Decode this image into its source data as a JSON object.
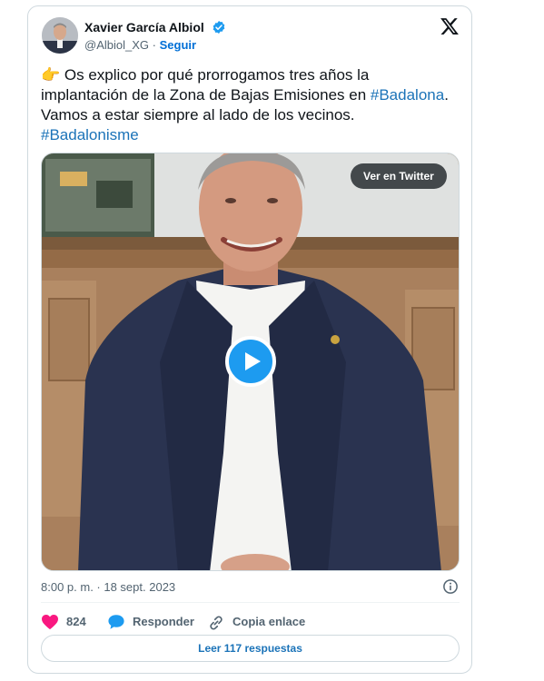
{
  "author": {
    "name": "Xavier García Albiol",
    "handle": "@Albiol_XG",
    "separator": "·",
    "follow_label": "Seguir"
  },
  "tweet": {
    "emoji": "👉",
    "line1": "Os explico por qué prorrogamos tres años la",
    "line2_text": "implantación de la Zona de Bajas Emisiones en ",
    "line2_hashtag": "#Badalona",
    "line2_end": ".",
    "line3": "Vamos a estar siempre al lado de los vecinos.",
    "line4_hashtag": "#Badalonisme"
  },
  "media": {
    "view_on_twitter": "Ver en Twitter"
  },
  "timestamp": "8:00 p. m. · 18 sept. 2023",
  "actions": {
    "likes_count": "824",
    "reply_label": "Responder",
    "copy_link_label": "Copia enlace"
  },
  "read_replies": "Leer 117 respuestas",
  "colors": {
    "link": "#1b73b8",
    "like": "#f91880",
    "play": "#1d9bf0",
    "verified": "#1d9bf0"
  }
}
